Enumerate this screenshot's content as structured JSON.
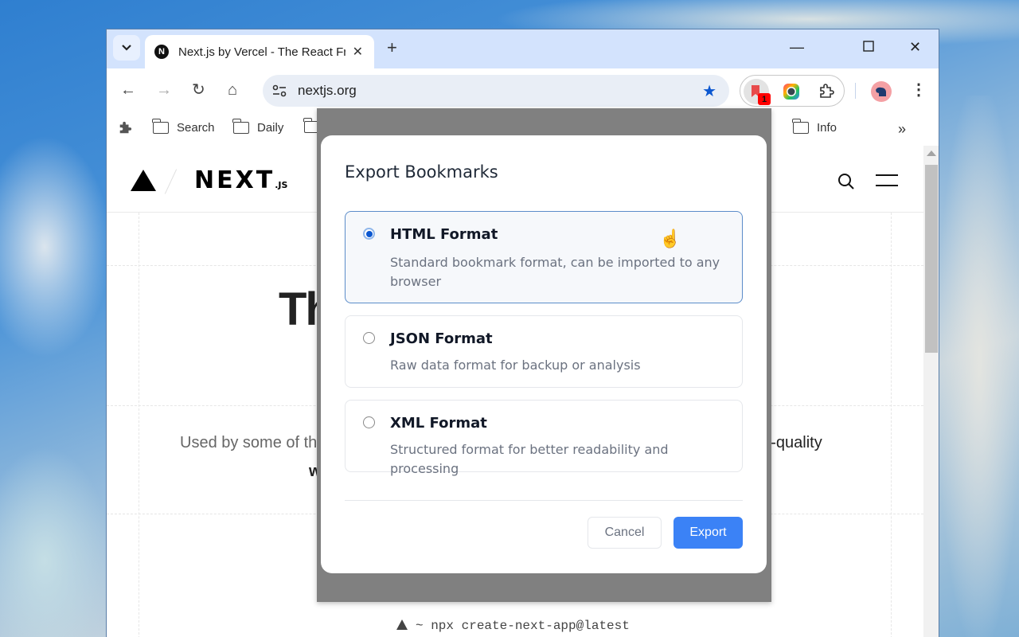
{
  "browser": {
    "tab": {
      "favicon": "N",
      "title": "Next.js by Vercel - The React Framework"
    },
    "new_tab_icon": "+",
    "window_controls": {
      "minimize": "—",
      "maximize": "☐",
      "close": "✕"
    },
    "nav": {
      "back": "←",
      "forward": "→",
      "reload": "↻",
      "home": "⌂"
    },
    "omnibox": {
      "url": "nextjs.org",
      "bookmarked_icon": "★"
    },
    "extensions": {
      "active_extension_badge": "1"
    },
    "menu_icon": "⋮",
    "bookmarks_bar": {
      "items": [
        {
          "label": "Search"
        },
        {
          "label": "Daily"
        },
        {
          "label": "Info"
        }
      ],
      "overflow_icon": "»"
    }
  },
  "page": {
    "logo_text": "NEXT",
    "logo_suffix": ".JS",
    "hero_title_partial": "Th",
    "hero_sub_left": "Used by some of th",
    "hero_sub_right": "gh-quality",
    "hero_sub2_partial": "w",
    "cli_command": "~ npx create-next-app@latest"
  },
  "dialog": {
    "title": "Export Bookmarks",
    "options": [
      {
        "title": "HTML Format",
        "description": "Standard bookmark format, can be imported to any browser",
        "selected": true
      },
      {
        "title": "JSON Format",
        "description": "Raw data format for backup or analysis",
        "selected": false
      },
      {
        "title": "XML Format",
        "description": "Structured format for better readability and processing",
        "selected": false
      }
    ],
    "cancel_label": "Cancel",
    "export_label": "Export",
    "accent_color": "#3b82f6"
  }
}
